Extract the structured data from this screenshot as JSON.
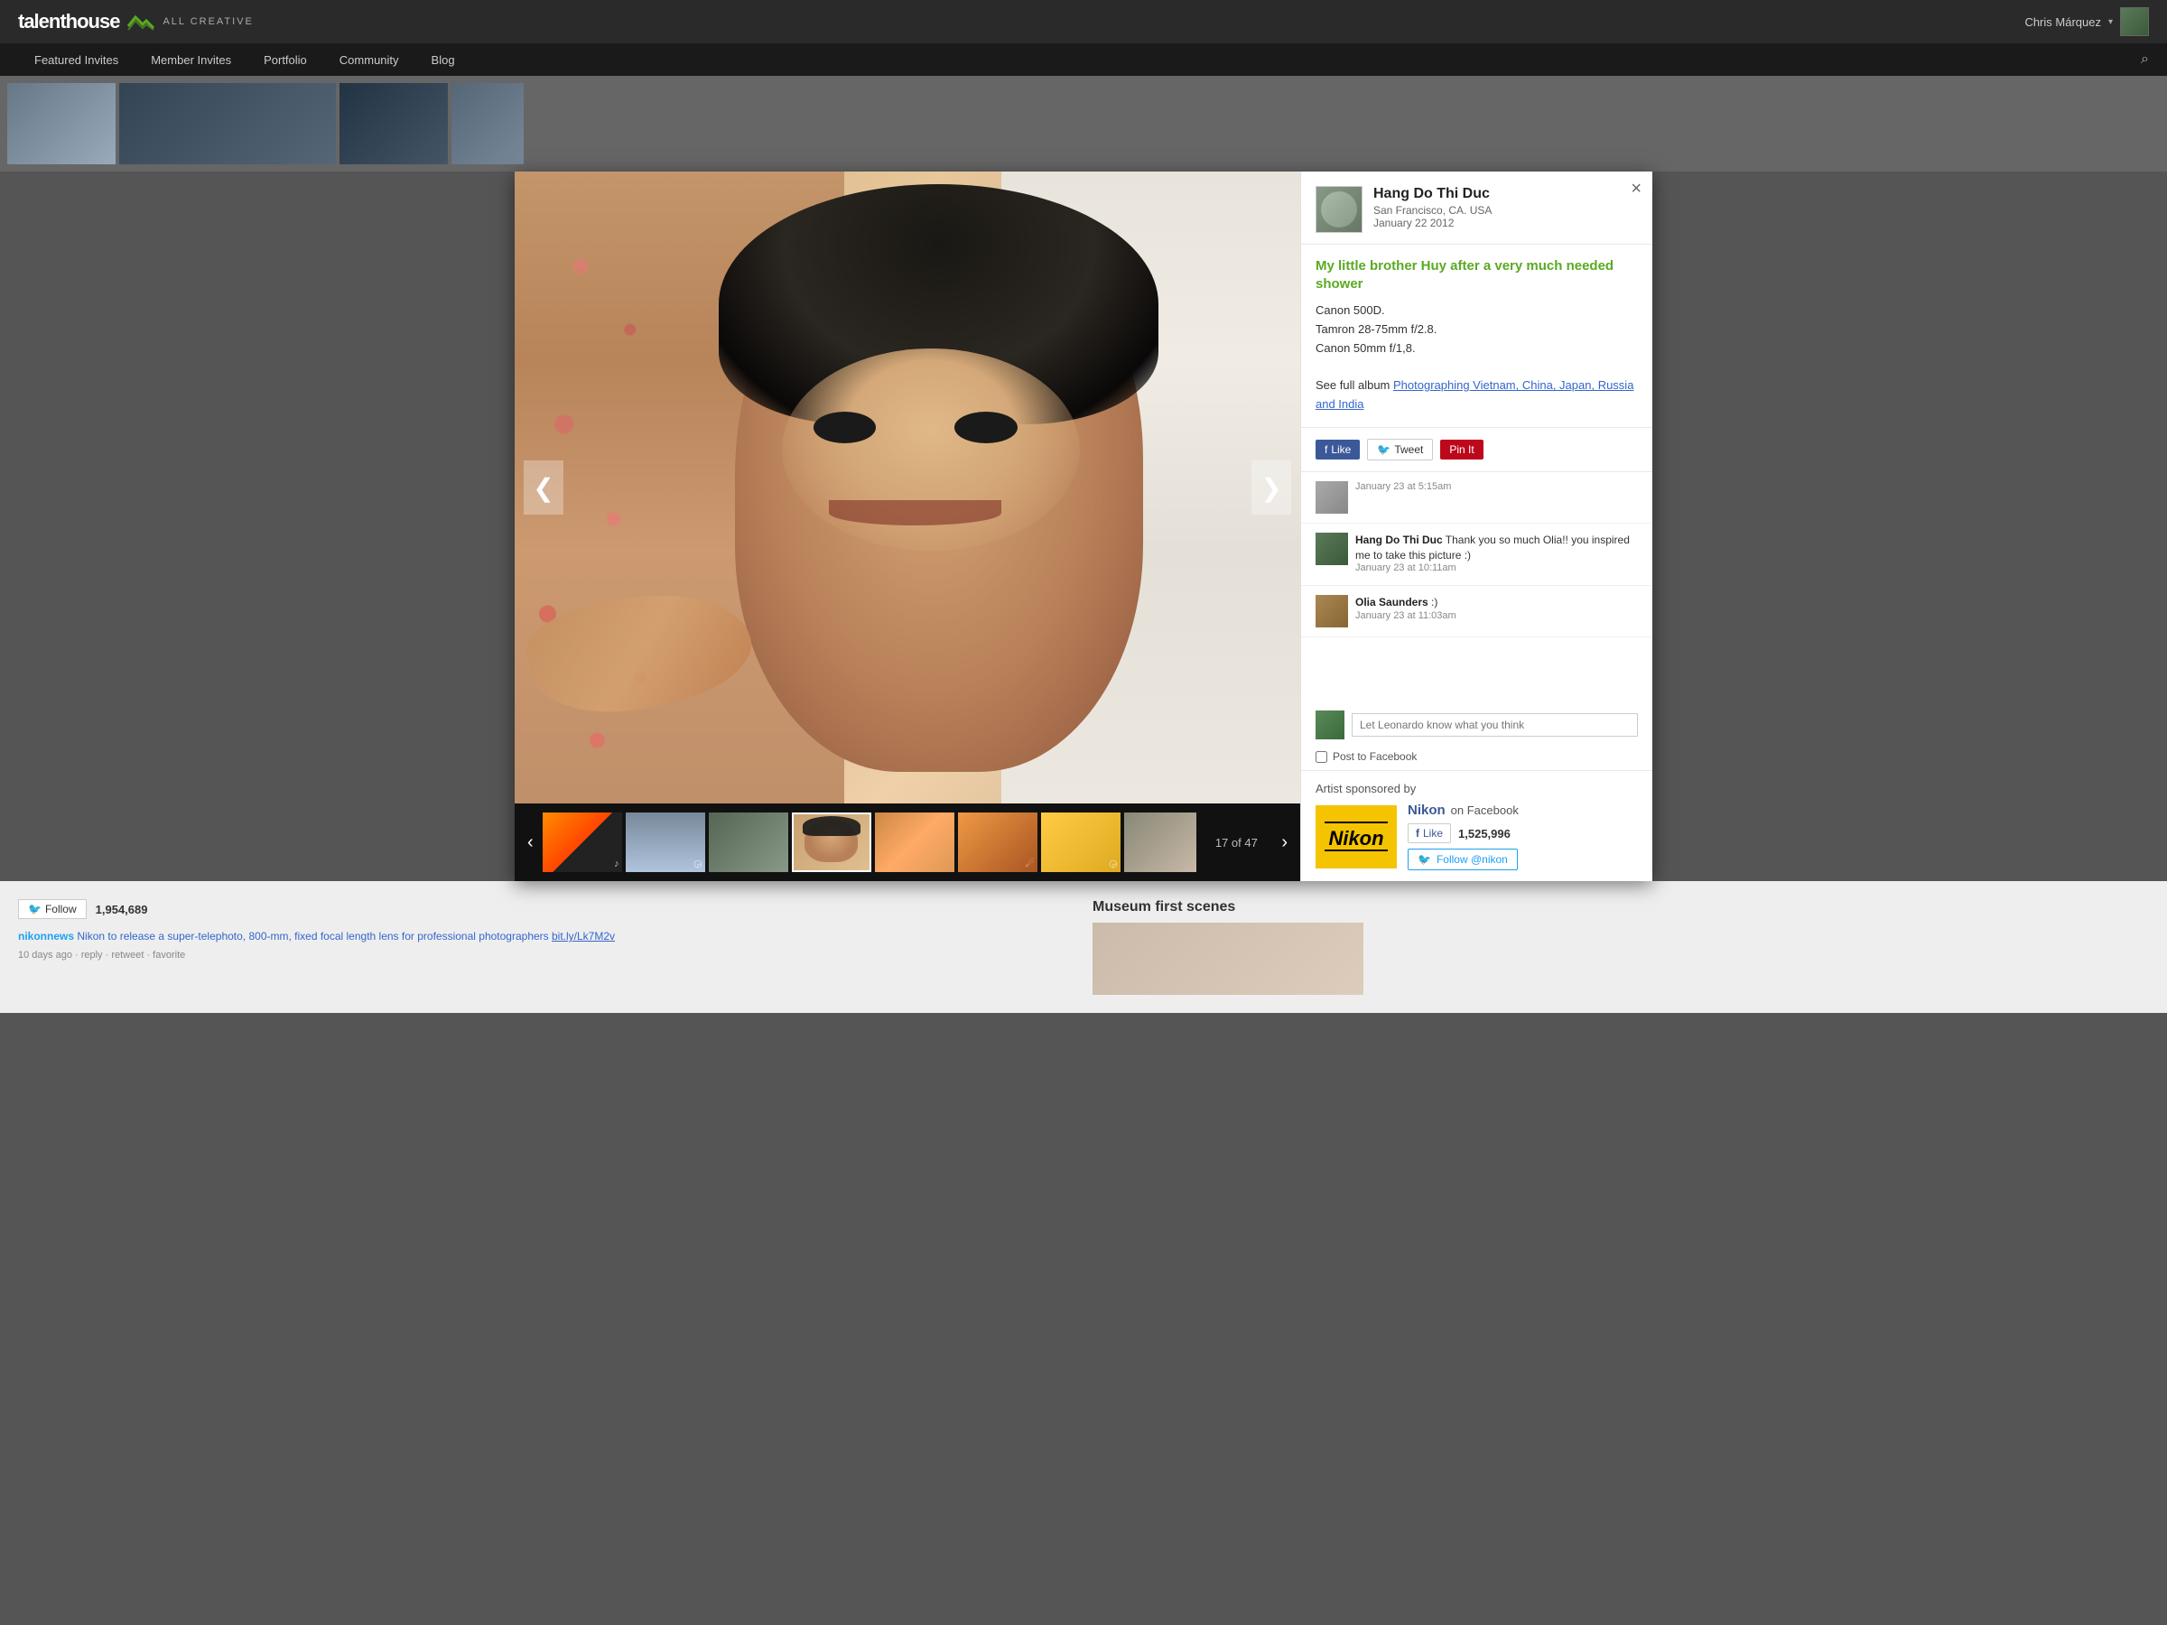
{
  "site": {
    "logo_text": "talenthouse",
    "tagline": "ALL CREATIVE"
  },
  "nav": {
    "user_name": "Chris Márquez",
    "items": [
      {
        "label": "Featured Invites",
        "active": false
      },
      {
        "label": "Member Invites",
        "active": false
      },
      {
        "label": "Portfolio",
        "active": false
      },
      {
        "label": "Community",
        "active": false
      },
      {
        "label": "Blog",
        "active": false
      }
    ]
  },
  "modal": {
    "close_label": "×",
    "artist": {
      "name": "Hang Do Thi Duc",
      "location": "San Francisco, CA. USA",
      "date": "January 22 2012"
    },
    "photo": {
      "title": "My little brother Huy after a very much needed shower",
      "desc_line1": "Canon 500D.",
      "desc_line2": "Tamron 28-75mm f/2.8.",
      "desc_line3": "Canon 50mm f/1,8.",
      "album_prefix": "See full album ",
      "album_link": "Photographing Vietnam, China, Japan, Russia and India"
    },
    "social": {
      "like_label": "Like",
      "tweet_label": "Tweet",
      "pin_label": "Pin It"
    },
    "comments": [
      {
        "time": "January 23 at 5:15am",
        "author": "",
        "text": ""
      },
      {
        "time": "January 23 at 10:11am",
        "author": "Hang Do Thi Duc",
        "text": "Thank you so much Olia!! you inspired me to take this picture :)"
      },
      {
        "time": "January 23 at 11:03am",
        "author": "Olia Saunders",
        "text": ":)"
      }
    ],
    "comment_input": {
      "placeholder": "Let Leonardo know what you think"
    },
    "post_to_fb_label": "Post to Facebook",
    "sponsor": {
      "title": "Artist sponsored by",
      "name": "Nikon",
      "on_label": "on Facebook",
      "like_count": "1,525,996",
      "like_label": "Like",
      "follow_label": "Follow @nikon"
    }
  },
  "counter": {
    "current": "17",
    "total": "47",
    "display": "17 of 47"
  },
  "background": {
    "twitter": {
      "follow_label": "Follow",
      "follower_count": "1,954,689",
      "handle": "nikonnews",
      "news_text": "Nikon to release a super-telephoto, 800-mm, fixed focal length lens for professional photographers",
      "news_link": "bit.ly/Lk7M2v",
      "meta": "10 days ago · reply · retweet · favorite"
    },
    "right_section": {
      "title": "Museum first scenes"
    }
  }
}
